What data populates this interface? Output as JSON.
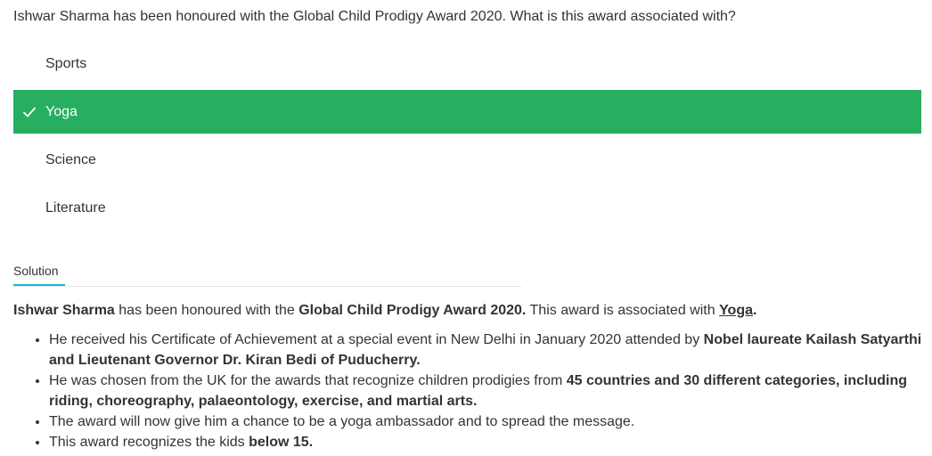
{
  "question": {
    "text": "Ishwar Sharma has been honoured with the Global Child Prodigy Award 2020. What is this award associated with?"
  },
  "options": [
    {
      "label": "Sports",
      "selected": false
    },
    {
      "label": "Yoga",
      "selected": true
    },
    {
      "label": "Science",
      "selected": false
    },
    {
      "label": "Literature",
      "selected": false
    }
  ],
  "solution": {
    "tab_label": "Solution",
    "answer": {
      "name": "Ishwar Sharma",
      "middle": " has been honoured with the ",
      "award": "Global Child Prodigy Award 2020.",
      "tail": " This award is associated with ",
      "correct": "Yoga",
      "end": "."
    },
    "points": [
      {
        "text": "He received his Certificate of Achievement at a special event in New Delhi in January 2020 attended by ",
        "bold": "Nobel laureate Kailash Satyarthi and Lieutenant Governor Dr. Kiran Bedi of Puducherry."
      },
      {
        "text": "He was chosen from the UK for the awards that recognize children prodigies from ",
        "bold": "45 countries and 30 different categories, including riding, choreography, palaeontology, exercise, and martial arts."
      },
      {
        "text": "The award will now give him a chance to be a yoga ambassador and to spread the message.",
        "bold": ""
      },
      {
        "text": "This award recognizes the kids ",
        "bold": "below 15."
      }
    ]
  },
  "colors": {
    "selected_bg": "#27ae60",
    "tab_accent": "#1ab3d9"
  }
}
